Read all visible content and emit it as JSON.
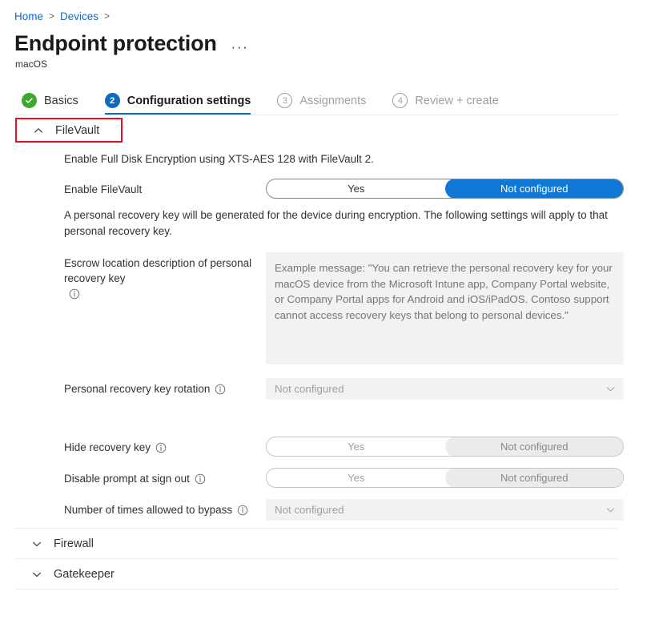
{
  "breadcrumb": {
    "items": [
      {
        "label": "Home"
      },
      {
        "label": "Devices"
      }
    ],
    "separator": ">"
  },
  "header": {
    "title": "Endpoint protection",
    "subtitle": "macOS",
    "more_actions": "···"
  },
  "wizard": {
    "steps": [
      {
        "badge": "✓",
        "label": "Basics",
        "state": "done"
      },
      {
        "badge": "2",
        "label": "Configuration settings",
        "state": "active"
      },
      {
        "badge": "3",
        "label": "Assignments",
        "state": "idle"
      },
      {
        "badge": "4",
        "label": "Review + create",
        "state": "idle"
      }
    ]
  },
  "sections": {
    "filevault": {
      "title": "FileVault",
      "expanded": true,
      "intro": "Enable Full Disk Encryption using XTS-AES 128 with FileVault 2.",
      "enable": {
        "label": "Enable FileVault",
        "options": [
          "Yes",
          "Not configured"
        ],
        "selected": "Not configured"
      },
      "recovery_note": "A personal recovery key will be generated for the device during encryption. The following settings will apply to that personal recovery key.",
      "escrow": {
        "label": "Escrow location description of personal recovery key",
        "placeholder": "Example message: \"You can retrieve the personal recovery key for your macOS device from the Microsoft Intune app, Company Portal website, or Company Portal apps for Android and iOS/iPadOS. Contoso support cannot access recovery keys that belong to personal devices.\"",
        "value": ""
      },
      "rotation": {
        "label": "Personal recovery key rotation",
        "value": "Not configured"
      },
      "hide_recovery_key": {
        "label": "Hide recovery key",
        "options": [
          "Yes",
          "Not configured"
        ],
        "selected": "Not configured"
      },
      "disable_prompt": {
        "label": "Disable prompt at sign out",
        "options": [
          "Yes",
          "Not configured"
        ],
        "selected": "Not configured"
      },
      "bypass": {
        "label": "Number of times allowed to bypass",
        "value": "Not configured"
      }
    },
    "firewall": {
      "title": "Firewall",
      "expanded": false
    },
    "gatekeeper": {
      "title": "Gatekeeper",
      "expanded": false
    }
  },
  "colors": {
    "accent": "#0f6cbd",
    "toggle_selected": "#0f78d4",
    "success": "#3fa72f",
    "annotation": "#e81123",
    "control_bg": "#f3f2f1"
  }
}
